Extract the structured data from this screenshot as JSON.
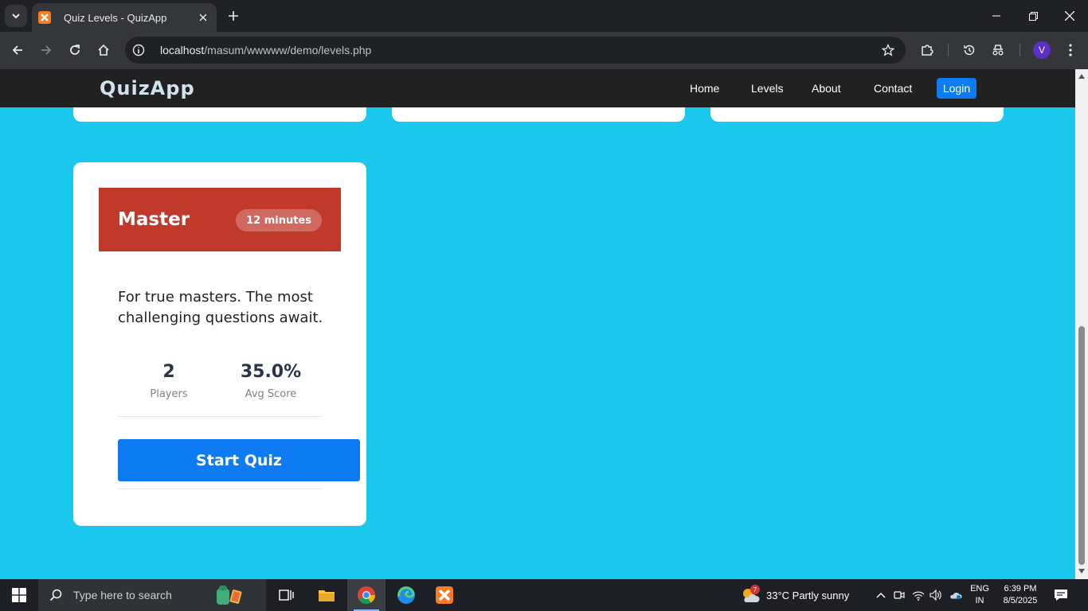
{
  "browser": {
    "tab_title": "Quiz Levels - QuizApp",
    "url_host": "localhost",
    "url_path": "/masum/wwwww/demo/levels.php",
    "profile_initial": "V"
  },
  "site": {
    "brand": "QuizApp",
    "nav": {
      "home": "Home",
      "levels": "Levels",
      "about": "About",
      "contact": "Contact",
      "login": "Login"
    }
  },
  "level_card": {
    "name": "Master",
    "duration": "12 minutes",
    "description": "For true masters. The most challenging questions await.",
    "stats": [
      {
        "value": "2",
        "label": "Players"
      },
      {
        "value": "35.0%",
        "label": "Avg Score"
      }
    ],
    "button": "Start Quiz",
    "header_color": "#c0392b"
  },
  "taskbar": {
    "search_placeholder": "Type here to search",
    "weather_badge": "7",
    "weather": "33°C  Partly sunny",
    "lang_line1": "ENG",
    "lang_line2": "IN",
    "time": "6:39 PM",
    "date": "8/5/2025"
  },
  "colors": {
    "page_background": "#1ac8ee",
    "navbar": "#212121",
    "primary_button": "#0d7cf2"
  }
}
